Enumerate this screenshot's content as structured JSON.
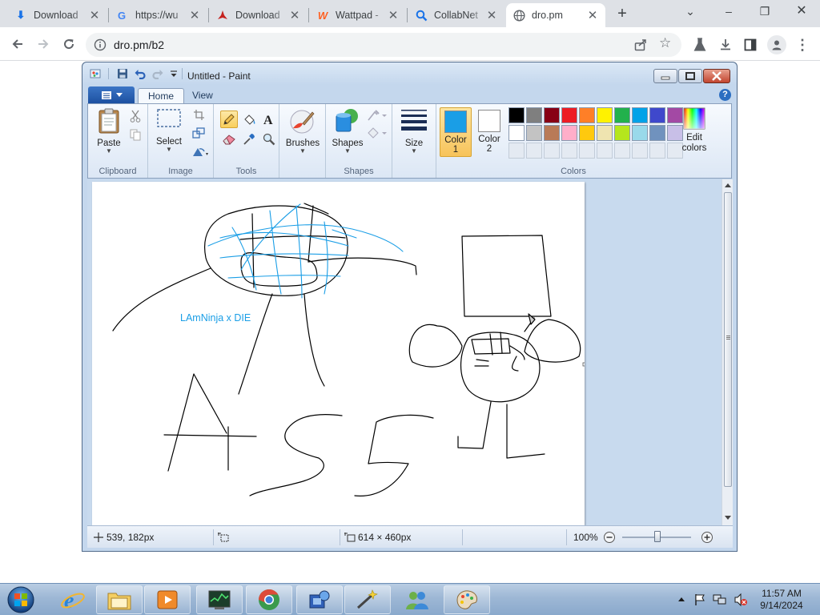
{
  "browser": {
    "tabs": [
      {
        "title": "Download",
        "icon": "download-icon",
        "active": false
      },
      {
        "title": "https://wu",
        "icon": "google-icon",
        "active": false
      },
      {
        "title": "Download",
        "icon": "pdf-icon",
        "active": false
      },
      {
        "title": "Wattpad -",
        "icon": "wattpad-icon",
        "active": false
      },
      {
        "title": "CollabNet",
        "icon": "magnifier-icon",
        "active": false
      },
      {
        "title": "dro.pm",
        "icon": "globe-icon",
        "active": true
      }
    ],
    "url": "dro.pm/b2"
  },
  "paint": {
    "title": "Untitled - Paint",
    "ribbon_tabs": [
      "Home",
      "View"
    ],
    "groups": {
      "clipboard": "Clipboard",
      "image": "Image",
      "tools": "Tools",
      "shapes": "Shapes",
      "colors": "Colors"
    },
    "buttons": {
      "paste": "Paste",
      "select": "Select",
      "brushes": "Brushes",
      "shapes": "Shapes",
      "size": "Size",
      "color1_label": "Color",
      "color1_num": "1",
      "color2_label": "Color",
      "color2_num": "2",
      "edit_colors_1": "Edit",
      "edit_colors_2": "colors"
    },
    "color1": "#1a9ee6",
    "color2": "#ffffff",
    "palette_row1": [
      "#000000",
      "#7f7f7f",
      "#880015",
      "#ed1c24",
      "#ff7f27",
      "#fff200",
      "#22b14c",
      "#00a2e8",
      "#3f48cc",
      "#a349a4"
    ],
    "palette_row2": [
      "#ffffff",
      "#c3c3c3",
      "#b97a57",
      "#ffaec9",
      "#ffc90e",
      "#efe4b0",
      "#b5e61d",
      "#99d9ea",
      "#7092be",
      "#c8bfe7"
    ],
    "canvas_text": "LAmNinja x DIE",
    "status": {
      "cursor": "539, 182px",
      "size": "614 × 460px",
      "zoom": "100%"
    }
  },
  "taskbar": {
    "time": "11:57 AM",
    "date": "9/14/2024"
  }
}
